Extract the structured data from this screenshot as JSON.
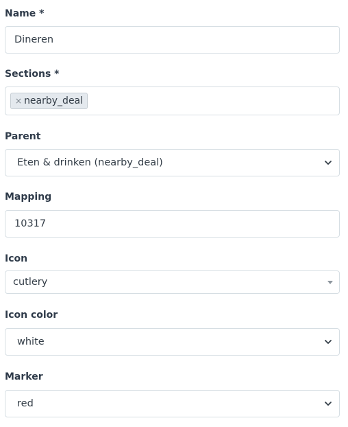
{
  "fields": {
    "name": {
      "label": "Name *",
      "value": "Dineren"
    },
    "sections": {
      "label": "Sections *",
      "tag_remove": "×",
      "tag": "nearby_deal"
    },
    "parent": {
      "label": "Parent",
      "value": "Eten & drinken (nearby_deal)"
    },
    "mapping": {
      "label": "Mapping",
      "value": "10317"
    },
    "icon": {
      "label": "Icon",
      "value": "cutlery"
    },
    "icon_color": {
      "label": "Icon color",
      "value": "white"
    },
    "marker": {
      "label": "Marker",
      "value": "red"
    }
  }
}
